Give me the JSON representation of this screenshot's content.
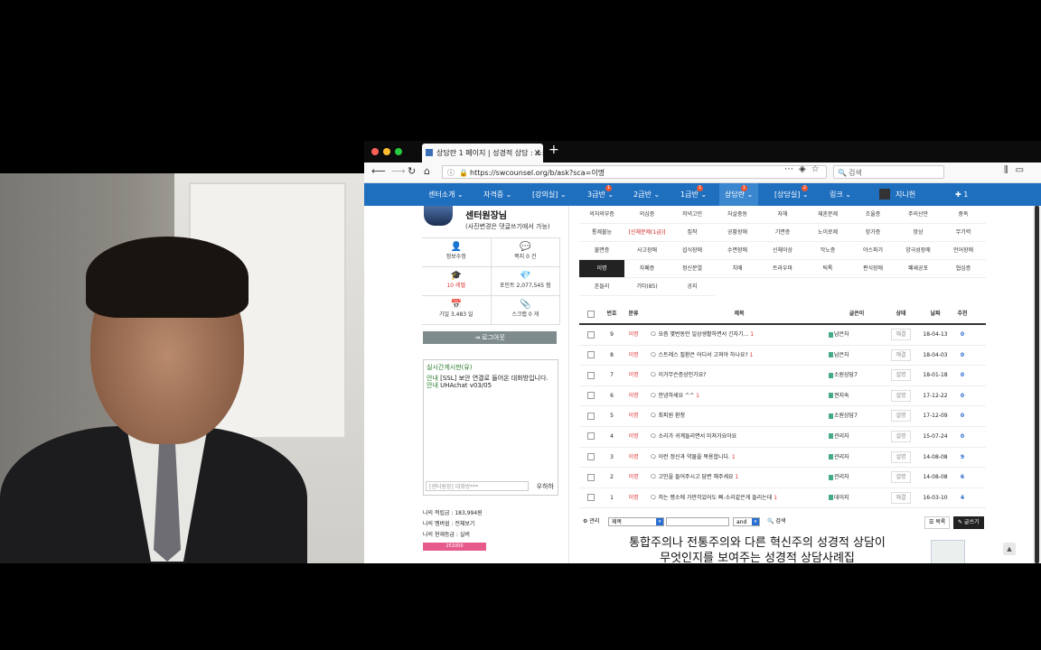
{
  "browser": {
    "tab_title": "상담란 1 페이지 | 성경적 상담 : 소금...",
    "url": "https://swcounsel.org/b/ask?sca=이명",
    "search_placeholder": "검색"
  },
  "nav": {
    "items": [
      {
        "label": "센터소개 ⌄",
        "badge": ""
      },
      {
        "label": "자격증 ⌄",
        "badge": ""
      },
      {
        "label": "[강의실] ⌄",
        "badge": ""
      },
      {
        "label": "3급반 ⌄",
        "badge": "1"
      },
      {
        "label": "2급반 ⌄",
        "badge": ""
      },
      {
        "label": "1급반 ⌄",
        "badge": "1"
      },
      {
        "label": "상담란 ⌄",
        "badge": "1"
      },
      {
        "label": "[상담실] ⌄",
        "badge": "2"
      },
      {
        "label": "링크 ⌄",
        "badge": ""
      }
    ],
    "helper": "지니헌",
    "extra": "✚ 1"
  },
  "profile": {
    "name": "센터원장님",
    "note": "(사진변경은 댓글쓰기에서 가능)",
    "stats": [
      {
        "icon": "user-edit-icon",
        "glyph": "👤",
        "label": "정보수정",
        "value": ""
      },
      {
        "icon": "chat-icon",
        "glyph": "💬",
        "label": "쪽지 0 건",
        "value": ""
      },
      {
        "icon": "graduation-icon",
        "glyph": "🎓",
        "label": "10 레벨",
        "value": ""
      },
      {
        "icon": "diamond-icon",
        "glyph": "💎",
        "label": "포인트 2,077,545 점",
        "value": ""
      },
      {
        "icon": "calendar-icon",
        "glyph": "📅",
        "label": "기일 3,483 일",
        "value": ""
      },
      {
        "icon": "paperclip-icon",
        "glyph": "📎",
        "label": "스크랩 0 개",
        "value": ""
      }
    ],
    "logout": "⇥ 로그아웃"
  },
  "chat": {
    "header": "실시간게시판(유)",
    "lines": [
      {
        "tag": "안내",
        "text": "[SSL] 보안 연결로 들어온 대화방입니다."
      },
      {
        "tag": "안내",
        "text": "UHAchat v03/05"
      }
    ],
    "input_placeholder": "[센터원장] 대화방***",
    "send": "우하하"
  },
  "myinfo": {
    "points": "나의 적립금 : 183,994원",
    "member": "나의 멤버쉽 : 전체보기",
    "grade": "나의 현재등급 : 실버",
    "bar": "251000"
  },
  "categories": [
    "의처의부증",
    "의심증",
    "저녁고민",
    "자살충동",
    "자해",
    "재혼문제",
    "조울증",
    "주의산만",
    "중독",
    "통제불능",
    "[신체문제(1급)]",
    "집착",
    "공황장애",
    "기면증",
    "노이로제",
    "망가증",
    "망상",
    "무기력",
    "불면증",
    "사고장애",
    "섭식장애",
    "수면장애",
    "신체이상",
    "악노증",
    "야스퍼거",
    "양극성장애",
    "언어장애",
    "이명",
    "자폐증",
    "정신분열",
    "치매",
    "트라우마",
    "틱톡",
    "편식장애",
    "폐쇄공포",
    "협심증",
    "흔들리",
    "기타(85)",
    "공지"
  ],
  "active_category": "이명",
  "table": {
    "headers": {
      "no": "번호",
      "cat": "분류",
      "title": "제목",
      "author": "글쓴이",
      "status": "상태",
      "date": "날짜",
      "rec": "추천"
    },
    "rows": [
      {
        "no": "9",
        "cat": "이명",
        "title": "요즘 몇번동안 일상생활하면서 긴자기...",
        "cm": "1",
        "author": "남은자",
        "status": "해결",
        "date": "18-04-13",
        "rec": "0"
      },
      {
        "no": "8",
        "cat": "이명",
        "title": "스트레스 질환은 어디서 고쳐야 하나요?",
        "cm": "1",
        "author": "남은자",
        "status": "해결",
        "date": "18-04-03",
        "rec": "0"
      },
      {
        "no": "7",
        "cat": "이명",
        "title": "이거무슨증상인가요?",
        "cm": "",
        "author": "소원상담7",
        "status": "설명",
        "date": "18-01-18",
        "rec": "0"
      },
      {
        "no": "6",
        "cat": "이명",
        "title": "안녕하세요 ^^",
        "cm": "1",
        "author": "권지숙",
        "status": "설명",
        "date": "17-12-22",
        "rec": "0"
      },
      {
        "no": "5",
        "cat": "이명",
        "title": "최피원 환청",
        "cm": "",
        "author": "소원상담7",
        "status": "설명",
        "date": "17-12-09",
        "rec": "0"
      },
      {
        "no": "4",
        "cat": "이명",
        "title": "소리가 귀계들리면서 미쳐가요아요",
        "cm": "",
        "author": "관리자",
        "status": "설명",
        "date": "15-07-24",
        "rec": "0"
      },
      {
        "no": "3",
        "cat": "이명",
        "title": "이런 정신과 약물을 복용합니다.",
        "cm": "1",
        "author": "관리자",
        "status": "설명",
        "date": "14-08-08",
        "rec": "9"
      },
      {
        "no": "2",
        "cat": "이명",
        "title": "고민을 들어주시고 답변 해주세요",
        "cm": "1",
        "author": "관리자",
        "status": "설명",
        "date": "14-08-08",
        "rec": "6"
      },
      {
        "no": "1",
        "cat": "이명",
        "title": "저는 평소에 가만히있어도 삐-소리같은게 들리는데",
        "cm": "1",
        "author": "데이지",
        "status": "해결",
        "date": "16-03-10",
        "rec": "4"
      }
    ]
  },
  "toolbar": {
    "admin": "⚙ 관리",
    "field": "제목",
    "op": "and",
    "search": "🔍 검색",
    "list": "☰ 목록",
    "write": "✎ 글쓰기"
  },
  "promo": {
    "line1": "통합주의나 전통주의와 다른 혁신주의 성경적 상담이",
    "line2": "무엇인지를 보여주는 성경적 상담사례집"
  },
  "social": {
    "fb": "f"
  }
}
